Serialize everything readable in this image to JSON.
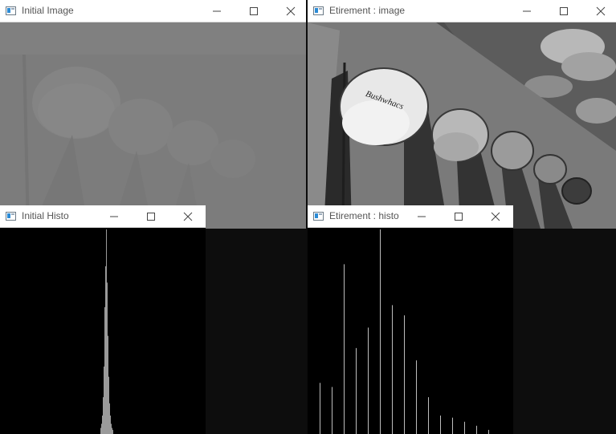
{
  "windows": {
    "initial_image": {
      "title": "Initial Image"
    },
    "etirement_image": {
      "title": "Etirement : image",
      "cap_text": "Bushwhacs"
    },
    "initial_histo": {
      "title": "Initial Histo"
    },
    "etirement_histo": {
      "title": "Etirement : histo"
    }
  },
  "icons": [
    "app-icon",
    "minimize-icon",
    "maximize-icon",
    "close-icon"
  ],
  "histograms": {
    "initial_histo": {
      "x_range": [
        0,
        255
      ],
      "y_range": [
        0,
        1
      ],
      "bins": [
        [
          125,
          0.03
        ],
        [
          126,
          0.05
        ],
        [
          127,
          0.09
        ],
        [
          128,
          0.18
        ],
        [
          129,
          0.33
        ],
        [
          130,
          0.62
        ],
        [
          131,
          0.82
        ],
        [
          132,
          1.0
        ],
        [
          133,
          0.74
        ],
        [
          134,
          0.48
        ],
        [
          135,
          0.28
        ],
        [
          136,
          0.15
        ],
        [
          137,
          0.09
        ],
        [
          138,
          0.05
        ],
        [
          139,
          0.03
        ],
        [
          140,
          0.02
        ]
      ]
    },
    "etirement_histo": {
      "x_range": [
        0,
        255
      ],
      "y_range": [
        0,
        1
      ],
      "bins": [
        [
          15,
          0.25
        ],
        [
          30,
          0.23
        ],
        [
          45,
          0.83
        ],
        [
          60,
          0.42
        ],
        [
          75,
          0.52
        ],
        [
          90,
          1.0
        ],
        [
          105,
          0.63
        ],
        [
          120,
          0.58
        ],
        [
          135,
          0.36
        ],
        [
          150,
          0.18
        ],
        [
          165,
          0.09
        ],
        [
          180,
          0.08
        ],
        [
          195,
          0.06
        ],
        [
          210,
          0.04
        ],
        [
          225,
          0.02
        ]
      ]
    }
  }
}
